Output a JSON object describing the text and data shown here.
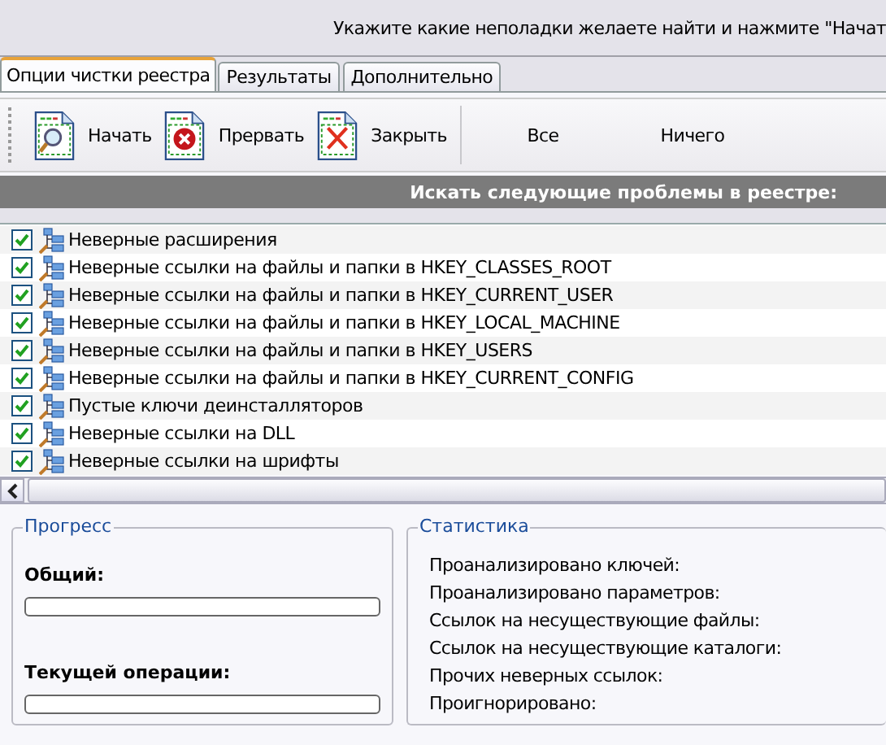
{
  "instruction": "Укажите какие неполадки желаете найти и нажмите \"Начат",
  "tabs": [
    {
      "label": "Опции чистки реестра",
      "selected": true
    },
    {
      "label": "Результаты",
      "selected": false
    },
    {
      "label": "Дополнительно",
      "selected": false
    }
  ],
  "toolbar": [
    {
      "label": "Начать",
      "kind": "start"
    },
    {
      "label": "Прервать",
      "kind": "stop"
    },
    {
      "label": "Закрыть",
      "kind": "close"
    },
    {
      "label": "Все",
      "kind": "text"
    },
    {
      "label": "Ничего",
      "kind": "text"
    }
  ],
  "list_header": "Искать следующие проблемы в реестре:",
  "problems": [
    {
      "label": "Неверные расширения",
      "checked": true
    },
    {
      "label": "Неверные ссылки на файлы и папки в HKEY_CLASSES_ROOT",
      "checked": true
    },
    {
      "label": "Неверные ссылки на файлы и папки в HKEY_CURRENT_USER",
      "checked": true
    },
    {
      "label": "Неверные ссылки на файлы и папки в HKEY_LOCAL_MACHINE",
      "checked": true
    },
    {
      "label": "Неверные ссылки на файлы и папки в HKEY_USERS",
      "checked": true
    },
    {
      "label": "Неверные ссылки на файлы и папки в HKEY_CURRENT_CONFIG",
      "checked": true
    },
    {
      "label": "Пустые ключи деинсталляторов",
      "checked": true
    },
    {
      "label": "Неверные ссылки на DLL",
      "checked": true
    },
    {
      "label": "Неверные ссылки на шрифты",
      "checked": true
    }
  ],
  "progress": {
    "title": "Прогресс",
    "bars": [
      {
        "label": "Общий:",
        "level": 0
      },
      {
        "label": "Текущей операции:",
        "level": 0
      }
    ]
  },
  "statistics": {
    "title": "Статистика",
    "items": [
      "Проанализировано ключей:",
      "Проанализировано параметров:",
      "Ссылок на несуществующие файлы:",
      "Ссылок на несуществующие каталоги:",
      "Прочих неверных ссылок:",
      "Проигнорировано:"
    ]
  }
}
